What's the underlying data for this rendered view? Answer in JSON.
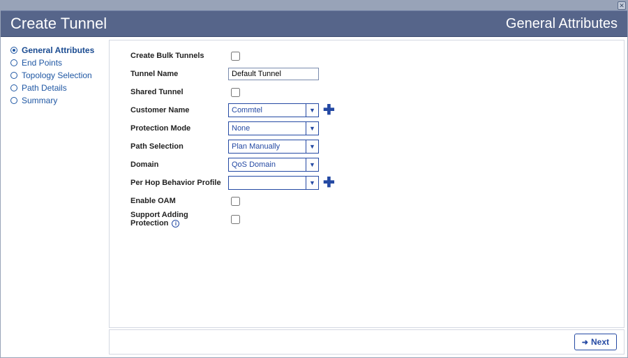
{
  "header": {
    "title": "Create Tunnel",
    "subtitle": "General Attributes"
  },
  "sidebar": {
    "items": [
      {
        "label": "General Attributes",
        "active": true
      },
      {
        "label": "End Points",
        "active": false
      },
      {
        "label": "Topology Selection",
        "active": false
      },
      {
        "label": "Path Details",
        "active": false
      },
      {
        "label": "Summary",
        "active": false
      }
    ]
  },
  "form": {
    "create_bulk_label": "Create Bulk Tunnels",
    "create_bulk_checked": false,
    "tunnel_name_label": "Tunnel Name",
    "tunnel_name_value": "Default Tunnel",
    "shared_tunnel_label": "Shared Tunnel",
    "shared_tunnel_checked": false,
    "customer_name_label": "Customer Name",
    "customer_name_value": "Commtel",
    "protection_mode_label": "Protection Mode",
    "protection_mode_value": "None",
    "path_selection_label": "Path Selection",
    "path_selection_value": "Plan Manually",
    "domain_label": "Domain",
    "domain_value": "QoS Domain",
    "phb_label": "Per Hop Behavior Profile",
    "phb_value": "",
    "enable_oam_label": "Enable OAM",
    "enable_oam_checked": false,
    "support_add_prot_label": "Support Adding Protection",
    "support_add_prot_checked": false
  },
  "footer": {
    "next_label": "Next"
  }
}
